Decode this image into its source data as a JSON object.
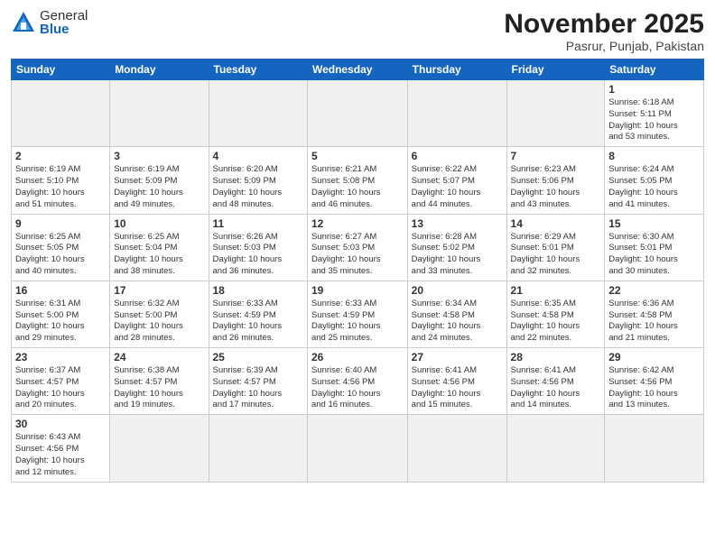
{
  "logo": {
    "general": "General",
    "blue": "Blue"
  },
  "title": "November 2025",
  "location": "Pasrur, Punjab, Pakistan",
  "days_header": [
    "Sunday",
    "Monday",
    "Tuesday",
    "Wednesday",
    "Thursday",
    "Friday",
    "Saturday"
  ],
  "weeks": [
    [
      {
        "num": "",
        "info": ""
      },
      {
        "num": "",
        "info": ""
      },
      {
        "num": "",
        "info": ""
      },
      {
        "num": "",
        "info": ""
      },
      {
        "num": "",
        "info": ""
      },
      {
        "num": "",
        "info": ""
      },
      {
        "num": "1",
        "info": "Sunrise: 6:18 AM\nSunset: 5:11 PM\nDaylight: 10 hours\nand 53 minutes."
      }
    ],
    [
      {
        "num": "2",
        "info": "Sunrise: 6:19 AM\nSunset: 5:10 PM\nDaylight: 10 hours\nand 51 minutes."
      },
      {
        "num": "3",
        "info": "Sunrise: 6:19 AM\nSunset: 5:09 PM\nDaylight: 10 hours\nand 49 minutes."
      },
      {
        "num": "4",
        "info": "Sunrise: 6:20 AM\nSunset: 5:09 PM\nDaylight: 10 hours\nand 48 minutes."
      },
      {
        "num": "5",
        "info": "Sunrise: 6:21 AM\nSunset: 5:08 PM\nDaylight: 10 hours\nand 46 minutes."
      },
      {
        "num": "6",
        "info": "Sunrise: 6:22 AM\nSunset: 5:07 PM\nDaylight: 10 hours\nand 44 minutes."
      },
      {
        "num": "7",
        "info": "Sunrise: 6:23 AM\nSunset: 5:06 PM\nDaylight: 10 hours\nand 43 minutes."
      },
      {
        "num": "8",
        "info": "Sunrise: 6:24 AM\nSunset: 5:05 PM\nDaylight: 10 hours\nand 41 minutes."
      }
    ],
    [
      {
        "num": "9",
        "info": "Sunrise: 6:25 AM\nSunset: 5:05 PM\nDaylight: 10 hours\nand 40 minutes."
      },
      {
        "num": "10",
        "info": "Sunrise: 6:25 AM\nSunset: 5:04 PM\nDaylight: 10 hours\nand 38 minutes."
      },
      {
        "num": "11",
        "info": "Sunrise: 6:26 AM\nSunset: 5:03 PM\nDaylight: 10 hours\nand 36 minutes."
      },
      {
        "num": "12",
        "info": "Sunrise: 6:27 AM\nSunset: 5:03 PM\nDaylight: 10 hours\nand 35 minutes."
      },
      {
        "num": "13",
        "info": "Sunrise: 6:28 AM\nSunset: 5:02 PM\nDaylight: 10 hours\nand 33 minutes."
      },
      {
        "num": "14",
        "info": "Sunrise: 6:29 AM\nSunset: 5:01 PM\nDaylight: 10 hours\nand 32 minutes."
      },
      {
        "num": "15",
        "info": "Sunrise: 6:30 AM\nSunset: 5:01 PM\nDaylight: 10 hours\nand 30 minutes."
      }
    ],
    [
      {
        "num": "16",
        "info": "Sunrise: 6:31 AM\nSunset: 5:00 PM\nDaylight: 10 hours\nand 29 minutes."
      },
      {
        "num": "17",
        "info": "Sunrise: 6:32 AM\nSunset: 5:00 PM\nDaylight: 10 hours\nand 28 minutes."
      },
      {
        "num": "18",
        "info": "Sunrise: 6:33 AM\nSunset: 4:59 PM\nDaylight: 10 hours\nand 26 minutes."
      },
      {
        "num": "19",
        "info": "Sunrise: 6:33 AM\nSunset: 4:59 PM\nDaylight: 10 hours\nand 25 minutes."
      },
      {
        "num": "20",
        "info": "Sunrise: 6:34 AM\nSunset: 4:58 PM\nDaylight: 10 hours\nand 24 minutes."
      },
      {
        "num": "21",
        "info": "Sunrise: 6:35 AM\nSunset: 4:58 PM\nDaylight: 10 hours\nand 22 minutes."
      },
      {
        "num": "22",
        "info": "Sunrise: 6:36 AM\nSunset: 4:58 PM\nDaylight: 10 hours\nand 21 minutes."
      }
    ],
    [
      {
        "num": "23",
        "info": "Sunrise: 6:37 AM\nSunset: 4:57 PM\nDaylight: 10 hours\nand 20 minutes."
      },
      {
        "num": "24",
        "info": "Sunrise: 6:38 AM\nSunset: 4:57 PM\nDaylight: 10 hours\nand 19 minutes."
      },
      {
        "num": "25",
        "info": "Sunrise: 6:39 AM\nSunset: 4:57 PM\nDaylight: 10 hours\nand 17 minutes."
      },
      {
        "num": "26",
        "info": "Sunrise: 6:40 AM\nSunset: 4:56 PM\nDaylight: 10 hours\nand 16 minutes."
      },
      {
        "num": "27",
        "info": "Sunrise: 6:41 AM\nSunset: 4:56 PM\nDaylight: 10 hours\nand 15 minutes."
      },
      {
        "num": "28",
        "info": "Sunrise: 6:41 AM\nSunset: 4:56 PM\nDaylight: 10 hours\nand 14 minutes."
      },
      {
        "num": "29",
        "info": "Sunrise: 6:42 AM\nSunset: 4:56 PM\nDaylight: 10 hours\nand 13 minutes."
      }
    ],
    [
      {
        "num": "30",
        "info": "Sunrise: 6:43 AM\nSunset: 4:56 PM\nDaylight: 10 hours\nand 12 minutes."
      },
      {
        "num": "",
        "info": ""
      },
      {
        "num": "",
        "info": ""
      },
      {
        "num": "",
        "info": ""
      },
      {
        "num": "",
        "info": ""
      },
      {
        "num": "",
        "info": ""
      },
      {
        "num": "",
        "info": ""
      }
    ]
  ]
}
